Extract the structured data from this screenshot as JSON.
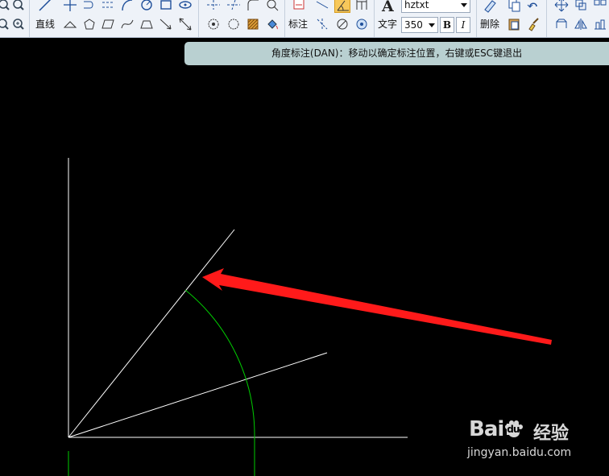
{
  "toolbar": {
    "line_label": "直线",
    "dim_label": "标注",
    "text_label": "文字",
    "font_name": "hztxt",
    "font_size": "350",
    "bold_label": "B",
    "italic_label": "I",
    "delete_label": "删除"
  },
  "status": {
    "prompt": "角度标注(DAN)：移动以确定标注位置，右键或ESC键退出"
  },
  "watermark": {
    "logo_text": "Bai",
    "logo_text2": "du",
    "jingyan": "经验",
    "url": "jingyan.baidu.com"
  },
  "colors": {
    "canvas_bg": "#000000",
    "geometry_line": "#ffffff",
    "dimension_arc": "#00cc00",
    "arrow": "#ff1a1a",
    "status_bar": "#b9d0d1",
    "toolbar_bg": "#eef2f8"
  }
}
